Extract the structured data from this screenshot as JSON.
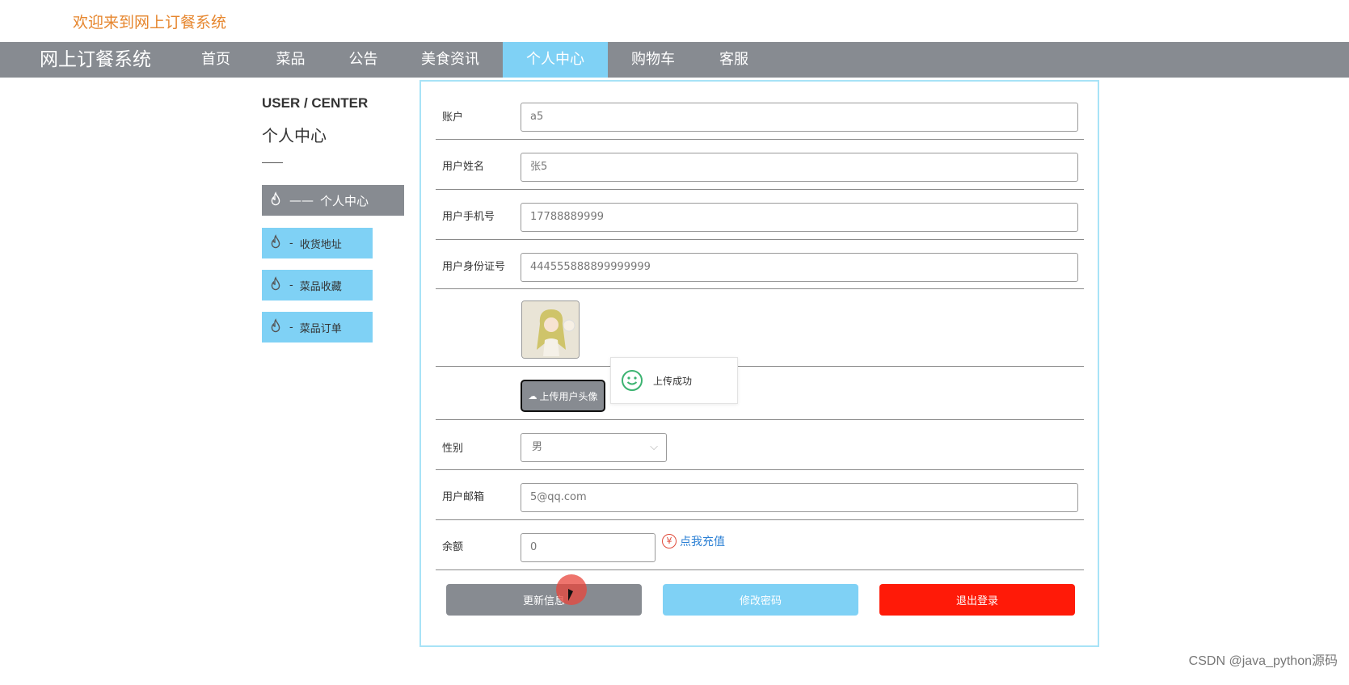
{
  "header": {
    "welcome": "欢迎来到网上订餐系统"
  },
  "nav": {
    "brand": "网上订餐系统",
    "items": [
      {
        "label": "首页"
      },
      {
        "label": "菜品"
      },
      {
        "label": "公告"
      },
      {
        "label": "美食资讯"
      },
      {
        "label": "个人中心"
      },
      {
        "label": "购物车"
      },
      {
        "label": "客服"
      }
    ],
    "active": "个人中心"
  },
  "sidebar": {
    "title_en": "USER / CENTER",
    "title_cn": "个人中心",
    "items": [
      {
        "label": "个人中心",
        "prefix": "——"
      },
      {
        "label": "收货地址",
        "prefix": "-"
      },
      {
        "label": "菜品收藏",
        "prefix": "-"
      },
      {
        "label": "菜品订单",
        "prefix": "-"
      }
    ]
  },
  "form": {
    "account": {
      "label": "账户",
      "value": "a5"
    },
    "name": {
      "label": "用户姓名",
      "value": "张5"
    },
    "phone": {
      "label": "用户手机号",
      "value": "17788889999"
    },
    "idcard": {
      "label": "用户身份证号",
      "value": "444555888899999999"
    },
    "upload_label": "上传用户头像",
    "gender": {
      "label": "性别",
      "value": "男"
    },
    "email": {
      "label": "用户邮箱",
      "value": "5@qq.com"
    },
    "balance": {
      "label": "余额",
      "value": "0"
    },
    "recharge_label": "点我充值"
  },
  "toast": {
    "message": "上传成功"
  },
  "buttons": {
    "update": "更新信息",
    "change_password": "修改密码",
    "logout": "退出登录"
  },
  "watermark": "CSDN @java_python源码",
  "colors": {
    "nav_bg": "#878b91",
    "accent": "#7fd1f5",
    "welcome": "#e6862e",
    "logout": "#ff1a08",
    "link": "#2a7fd4"
  }
}
